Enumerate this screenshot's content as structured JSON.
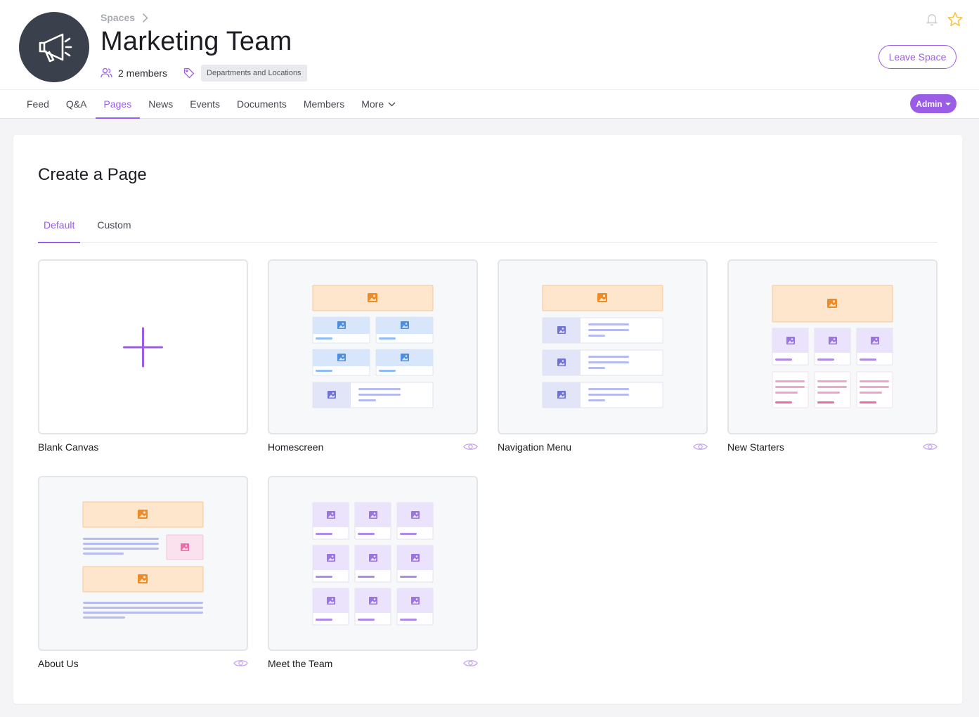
{
  "header": {
    "breadcrumb": "Spaces",
    "title": "Marketing Team",
    "members": "2 members",
    "tag": "Departments and Locations",
    "leave_label": "Leave Space",
    "icons": {
      "avatar": "megaphone-icon",
      "bell": "bell-icon",
      "star": "star-icon"
    }
  },
  "nav": {
    "items": [
      {
        "label": "Feed"
      },
      {
        "label": "Q&A"
      },
      {
        "label": "Pages",
        "active": true
      },
      {
        "label": "News"
      },
      {
        "label": "Events"
      },
      {
        "label": "Documents"
      },
      {
        "label": "Members"
      },
      {
        "label": "More"
      }
    ],
    "admin_label": "Admin"
  },
  "main": {
    "heading": "Create a Page",
    "tabs": [
      {
        "label": "Default",
        "active": true
      },
      {
        "label": "Custom"
      }
    ],
    "templates": [
      {
        "label": "Blank Canvas",
        "preview": "plus"
      },
      {
        "label": "Homescreen",
        "preview": "homescreen"
      },
      {
        "label": "Navigation Menu",
        "preview": "navigation"
      },
      {
        "label": "New Starters",
        "preview": "starters"
      },
      {
        "label": "About Us",
        "preview": "about"
      },
      {
        "label": "Meet the Team",
        "preview": "team"
      }
    ]
  },
  "colors": {
    "accent": "#9b5de5",
    "orange_fill": "#fde6cc",
    "orange_icon": "#f08a24",
    "blue_fill": "#d7e6fb",
    "blue_icon": "#4d8ee3",
    "blue_line": "#8ebdf5",
    "indigo_fill": "#e2e4f8",
    "indigo_icon": "#7173d6",
    "indigo_line": "#b6bbf0",
    "purple_fill": "#ebe3fb",
    "purple_icon": "#9a74e0",
    "purple_line": "#b08ae8",
    "pink_fill": "#fbe1ee",
    "pink_icon": "#ef6aa6",
    "pink_line": "#f4a3cb"
  }
}
